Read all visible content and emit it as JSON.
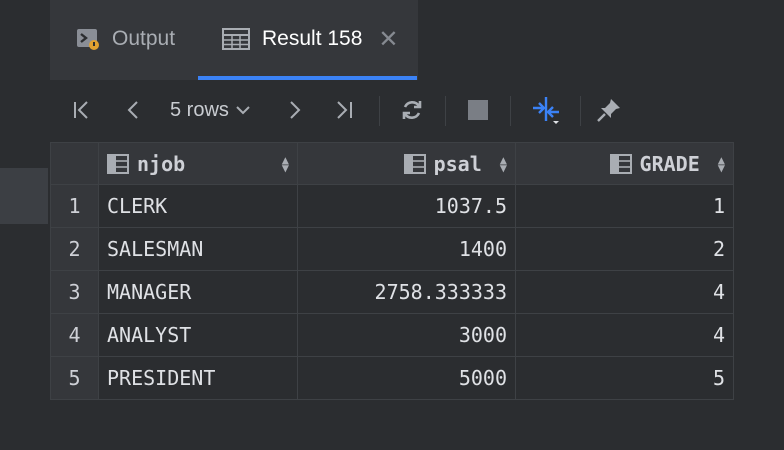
{
  "tabs": [
    {
      "label": "Output",
      "icon": "console-icon",
      "active": false
    },
    {
      "label": "Result 158",
      "icon": "table-icon",
      "active": true
    }
  ],
  "toolbar": {
    "rows_label": "5 rows",
    "icons": [
      "first-page-icon",
      "prev-page-icon",
      "next-page-icon",
      "last-page-icon",
      "refresh-icon",
      "stop-icon",
      "compare-icon",
      "pin-icon"
    ]
  },
  "colors": {
    "accent": "#3b82f6",
    "background": "#2b2d30",
    "header": "#35373b"
  },
  "table": {
    "columns": [
      "njob",
      "psal",
      "GRADE"
    ],
    "rows": [
      {
        "n": "1",
        "njob": "CLERK",
        "psal": "1037.5",
        "grade": "1"
      },
      {
        "n": "2",
        "njob": "SALESMAN",
        "psal": "1400",
        "grade": "2"
      },
      {
        "n": "3",
        "njob": "MANAGER",
        "psal": "2758.333333",
        "grade": "4"
      },
      {
        "n": "4",
        "njob": "ANALYST",
        "psal": "3000",
        "grade": "4"
      },
      {
        "n": "5",
        "njob": "PRESIDENT",
        "psal": "5000",
        "grade": "5"
      }
    ]
  }
}
